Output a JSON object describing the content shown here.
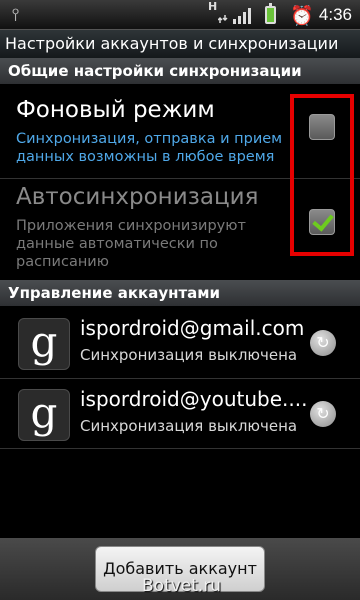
{
  "status_bar": {
    "time": "4:36",
    "network_type": "H",
    "icons": [
      "usb-icon",
      "hspa-icon",
      "signal-icon",
      "battery-charging-icon",
      "alarm-icon"
    ]
  },
  "title": "Настройки аккаунтов и синхронизации",
  "general_section": {
    "header": "Общие настройки синхронизации",
    "settings": [
      {
        "title": "Фоновый режим",
        "description": "Синхронизация, отправка и прием данных возможны в любое время",
        "checked": false,
        "title_color": "#ffffff",
        "description_color": "#4fa8e8"
      },
      {
        "title": "Автосинхронизация",
        "description": "Приложения синхронизируют данные автоматически по расписанию",
        "checked": true,
        "title_color": "#8a8a8a",
        "description_color": "#7a7a7a"
      }
    ]
  },
  "accounts_section": {
    "header": "Управление аккаунтами",
    "accounts": [
      {
        "icon": "g",
        "email": "ispordroid@gmail.com",
        "status": "Синхронизация выключена"
      },
      {
        "icon": "g",
        "email": "ispordroid@youtube....",
        "status": "Синхронизация выключена"
      }
    ]
  },
  "add_account_label": "Добавить аккаунт",
  "watermark": "Botvet.ru",
  "colors": {
    "highlight": "#e60000",
    "check": "#6dcc1e",
    "accent_blue": "#4fa8e8"
  }
}
